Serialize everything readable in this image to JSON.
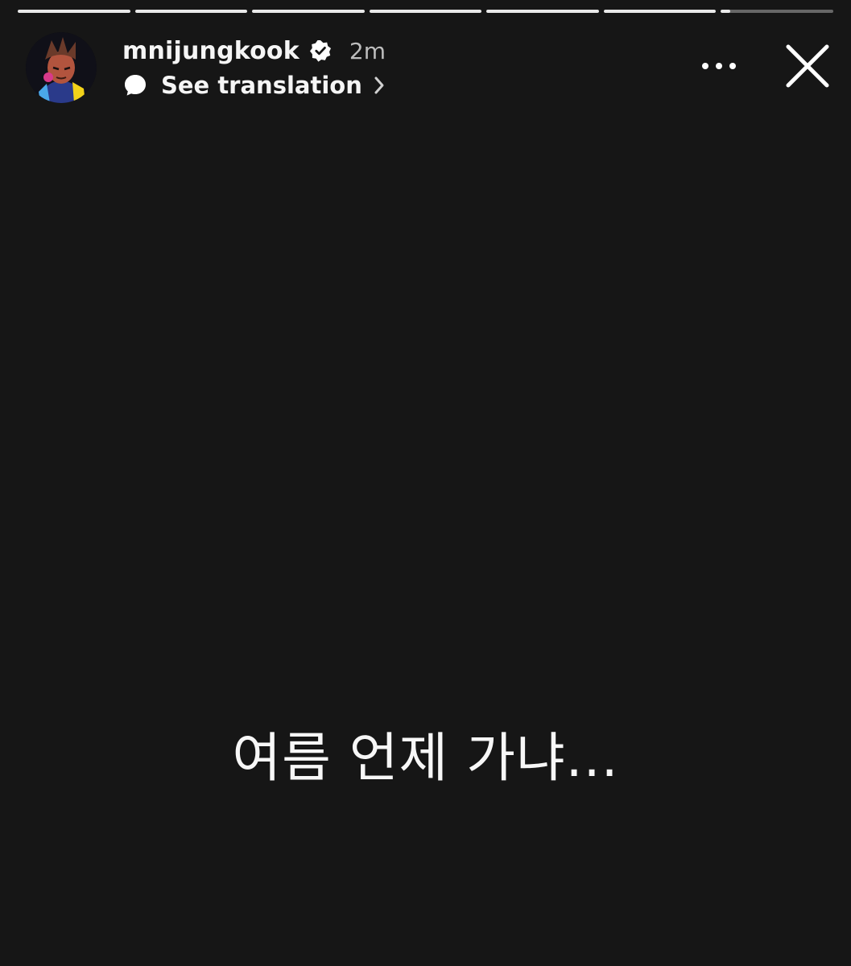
{
  "progress": {
    "segments": [
      1,
      1,
      1,
      1,
      1,
      1,
      0.08
    ]
  },
  "header": {
    "username": "mnijungkook",
    "timestamp": "2m",
    "translate_label": "See translation"
  },
  "story": {
    "text": "여름 언제 가냐..."
  },
  "icons": {
    "verified": "verified-badge-icon",
    "translate": "speech-bubble-icon",
    "chevron": "chevron-right-icon",
    "more": "more-dots-icon",
    "close": "close-icon"
  },
  "colors": {
    "background": "#161616",
    "text": "#ffffff",
    "progress_track": "#5c5c5c",
    "progress_fill": "#e9e9e9"
  }
}
